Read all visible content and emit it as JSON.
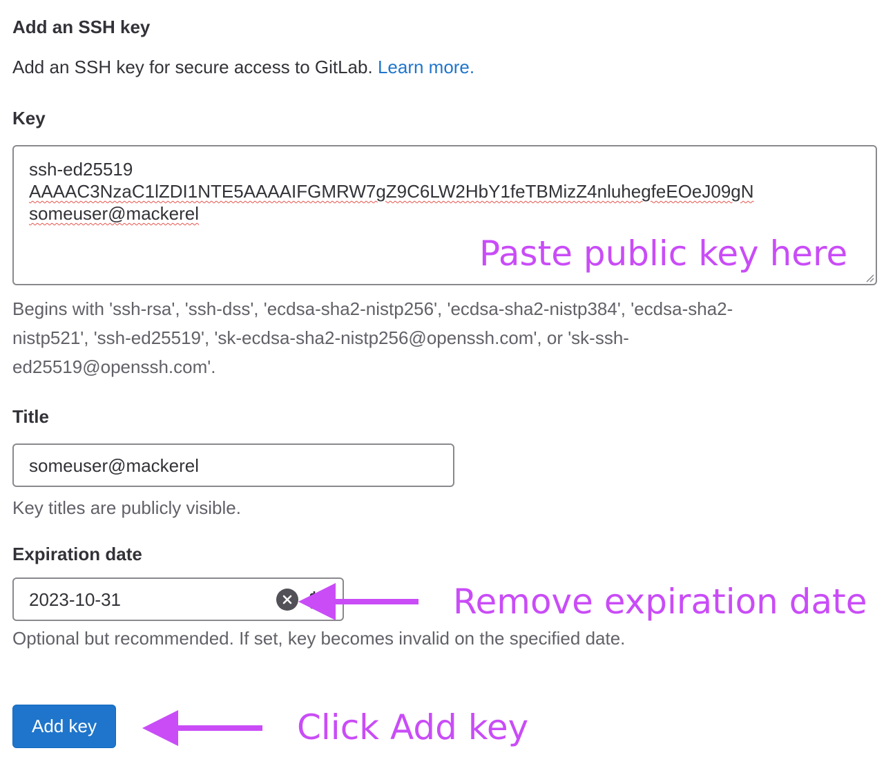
{
  "heading": "Add an SSH key",
  "intro": {
    "text": "Add an SSH key for secure access to GitLab.",
    "link": "Learn more."
  },
  "key": {
    "label": "Key",
    "lines": [
      "ssh-ed25519",
      "AAAAC3NzaC1lZDI1NTE5AAAAIFGMRW7gZ9C6LW2HbY1feTBMizZ4nluhegfeEOeJ09gN",
      "someuser@mackerel"
    ],
    "help_lines": [
      "Begins with 'ssh-rsa', 'ssh-dss', 'ecdsa-sha2-nistp256', 'ecdsa-sha2-nistp384', 'ecdsa-sha2-",
      "nistp521', 'ssh-ed25519', 'sk-ecdsa-sha2-nistp256@openssh.com', or 'sk-ssh-",
      "ed25519@openssh.com'."
    ]
  },
  "title": {
    "label": "Title",
    "value": "someuser@mackerel",
    "help": "Key titles are publicly visible."
  },
  "expiration": {
    "label": "Expiration date",
    "value": "2023-10-31",
    "help": "Optional but recommended. If set, key becomes invalid on the specified date."
  },
  "submit_label": "Add key",
  "annotations": {
    "paste": "Paste public key here",
    "remove": "Remove expiration date",
    "click": "Click Add key"
  },
  "colors": {
    "link": "#1f75cb",
    "button": "#1f75cb",
    "annotation": "#c94cf7"
  },
  "icons": [
    "clear-icon",
    "calendar-icon",
    "arrow-left-icon",
    "resize-handle-icon"
  ]
}
